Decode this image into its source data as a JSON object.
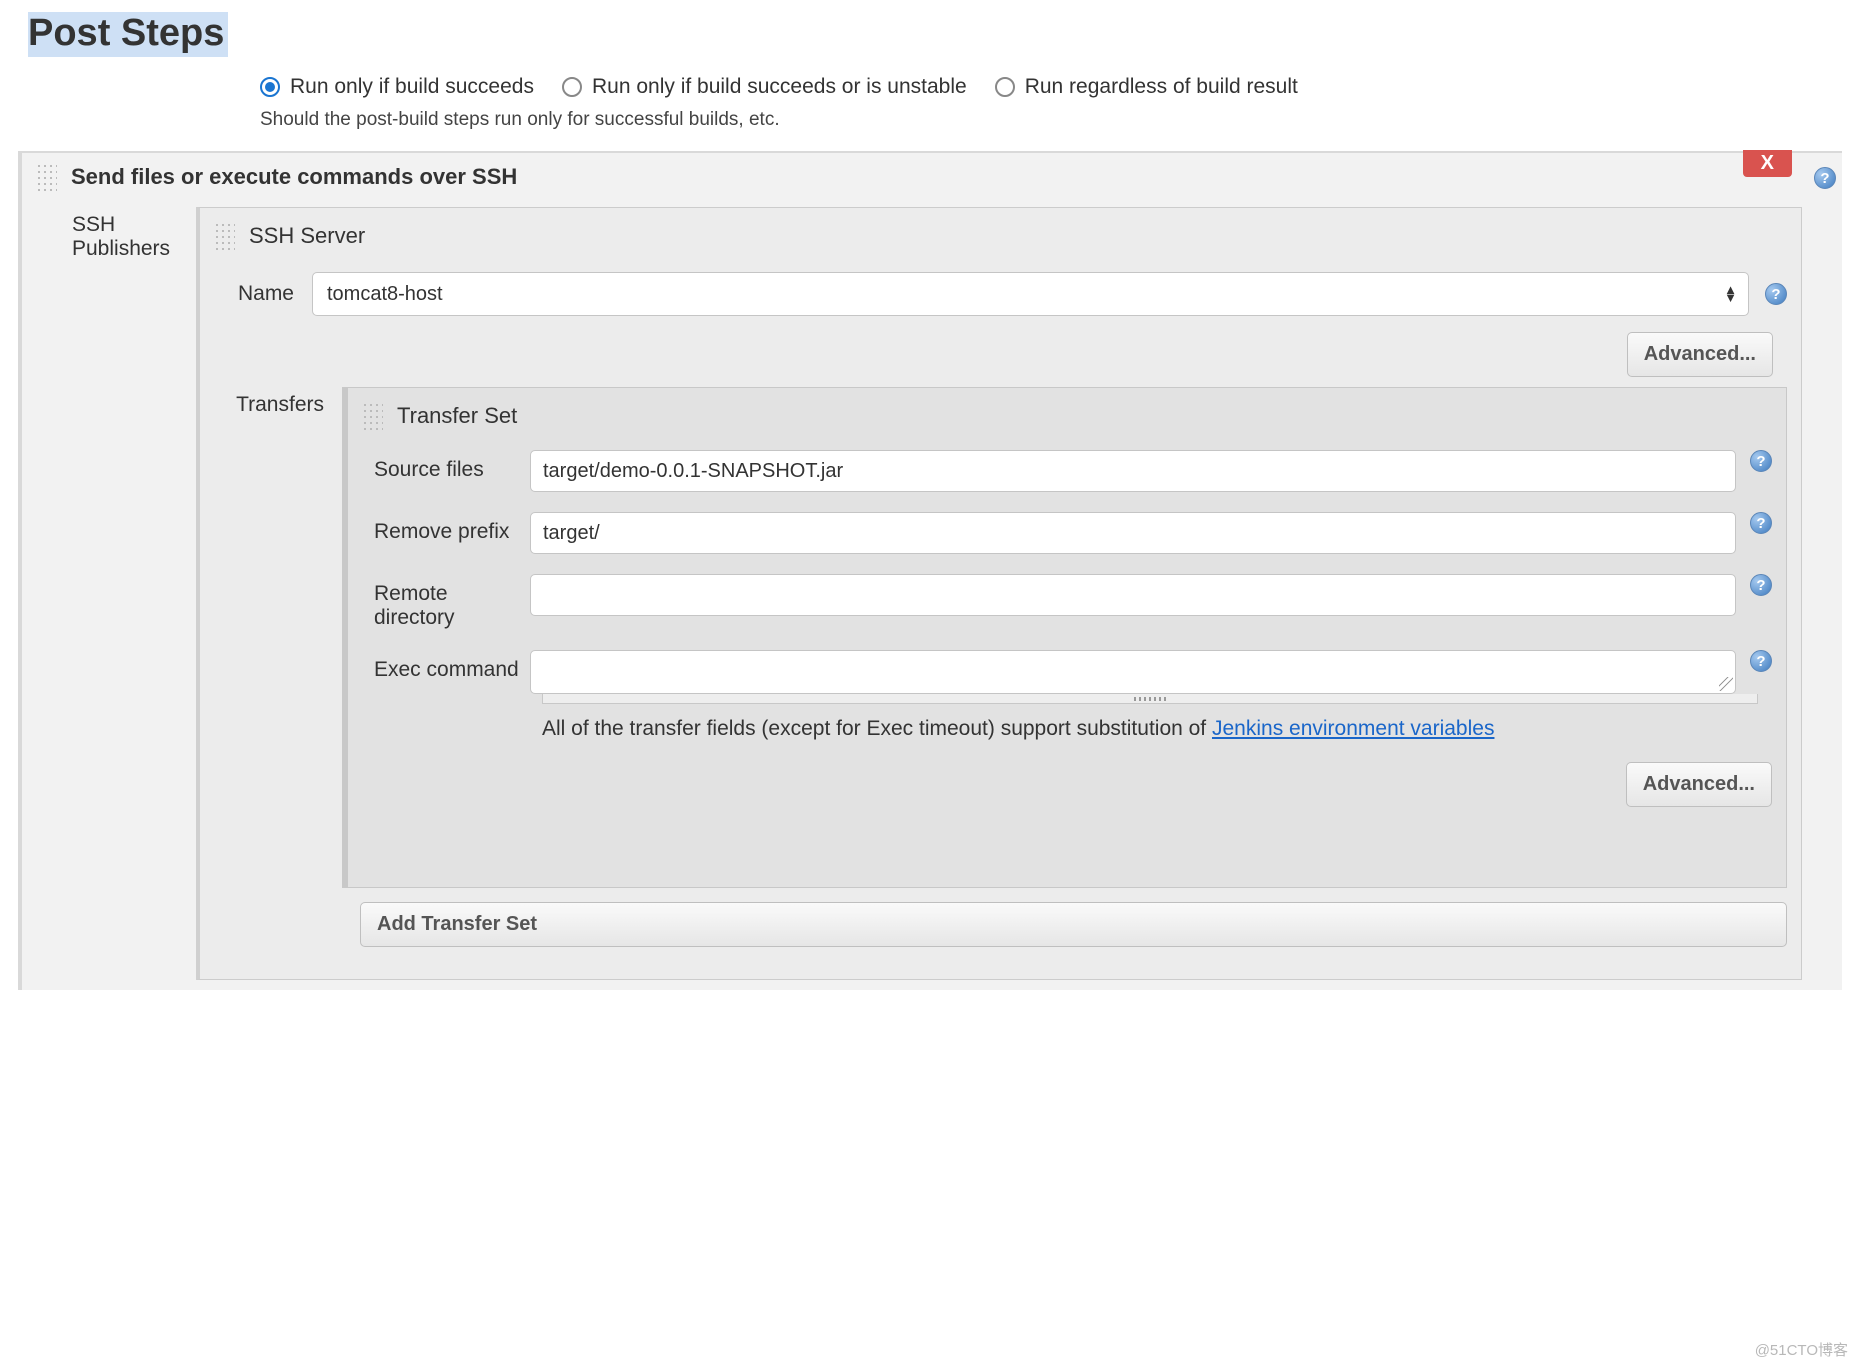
{
  "page": {
    "title": "Post Steps"
  },
  "conditions": {
    "opt1": "Run only if build succeeds",
    "opt2": "Run only if build succeeds or is unstable",
    "opt3": "Run regardless of build result",
    "selected": 0,
    "hint": "Should the post-build steps run only for successful builds, etc."
  },
  "ssh_section": {
    "title": "Send files or execute commands over SSH",
    "delete_label": "X",
    "publishers_label": "SSH Publishers",
    "server": {
      "header": "SSH Server",
      "name_label": "Name",
      "name_value": "tomcat8-host",
      "advanced_label": "Advanced..."
    },
    "transfers": {
      "label": "Transfers",
      "set_header": "Transfer Set",
      "source_label": "Source files",
      "source_value": "target/demo-0.0.1-SNAPSHOT.jar",
      "remove_label": "Remove prefix",
      "remove_value": "target/",
      "remote_label": "Remote directory",
      "remote_value": "",
      "exec_label": "Exec command",
      "exec_value": "",
      "note_pre": "All of the transfer fields (except for Exec timeout) support substitution of ",
      "note_link": "Jenkins environment variables",
      "advanced_label": "Advanced...",
      "add_label": "Add Transfer Set"
    }
  },
  "watermark": "@51CTO博客"
}
